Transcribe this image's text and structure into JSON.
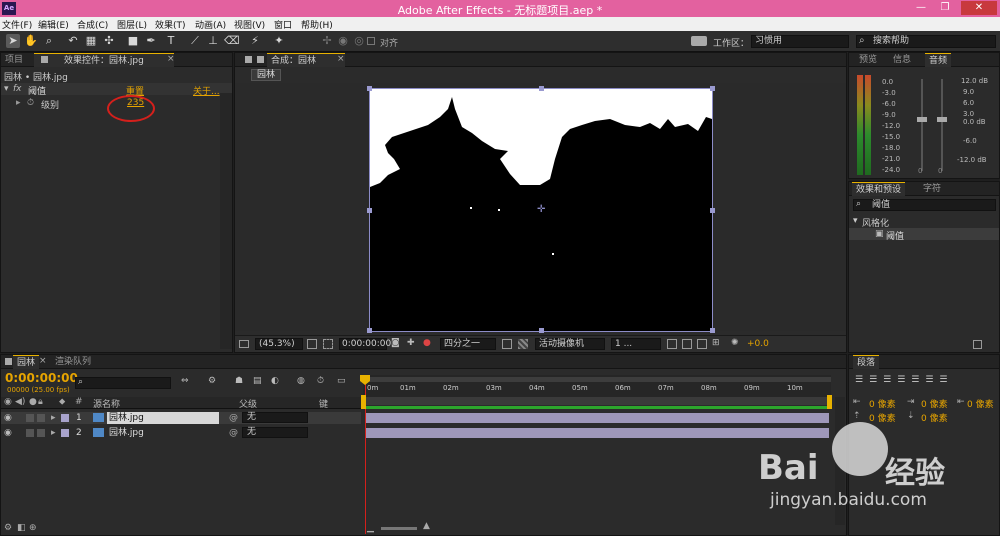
{
  "window": {
    "title": "Adobe After Effects - 无标题项目.aep *",
    "app_icon": "Ae"
  },
  "menu": [
    "文件(F)",
    "编辑(E)",
    "合成(C)",
    "图层(L)",
    "效果(T)",
    "动画(A)",
    "视图(V)",
    "窗口",
    "帮助(H)"
  ],
  "toolbar": {
    "align_label": "对齐",
    "workspace_label": "工作区：",
    "workspace_value": "习惯用",
    "search_placeholder": "搜索帮助"
  },
  "effect_controls": {
    "tab_project": "项目",
    "tab_label": "效果控件：园林.jpg",
    "layer_path": "园林 • 园林.jpg",
    "effect_name": "阈值",
    "reset_label": "重置",
    "about_label": "关于...",
    "param_label": "级别",
    "param_value": "235"
  },
  "composition": {
    "tab_label": "合成：园林",
    "comp_name": "园林",
    "zoom": "(45.3%)",
    "timecode": "0:00:00:00",
    "resolution": "四分之一",
    "camera": "活动摄像机",
    "views": "1 ...",
    "exposure": "+0.0"
  },
  "audio": {
    "tab_preview": "预览",
    "tab_info": "信息",
    "tab_audio": "音频",
    "left_scale": [
      "0.0",
      "-3.0",
      "-6.0",
      "-9.0",
      "-12.0",
      "-15.0",
      "-18.0",
      "-21.0",
      "-24.0"
    ],
    "right_scale_db": [
      "12.0 dB",
      "9.0",
      "6.0",
      "3.0",
      "0.0 dB",
      "-6.0",
      "-12.0 dB"
    ],
    "zero_a": "0",
    "zero_b": "0"
  },
  "effects_presets": {
    "tab_label": "效果和预设",
    "tab_char": "字符",
    "search_value": "阈值",
    "category": "风格化",
    "item": "阈值"
  },
  "paragraph": {
    "tab_label": "段落",
    "indent_a": "0 像素",
    "indent_b": "0 像素",
    "indent_c": "0 像素",
    "space_a": "0 像素",
    "space_b": "0 像素"
  },
  "timeline": {
    "tab_comp": "园林",
    "tab_render": "渲染队列",
    "timecode": "0:00:00:00",
    "frames": "00000 (25.00 fps)",
    "col_source": "源名称",
    "col_parent": "父级",
    "col_key": "键",
    "col_num": "#",
    "ruler": [
      "0m",
      "01m",
      "02m",
      "03m",
      "04m",
      "05m",
      "06m",
      "07m",
      "08m",
      "09m",
      "10m"
    ],
    "layers": [
      {
        "num": "1",
        "name": "园林.jpg",
        "parent": "无"
      },
      {
        "num": "2",
        "name": "园林.jpg",
        "parent": "无"
      }
    ]
  },
  "watermark": {
    "brand": "Bai",
    "cn": "经验",
    "url": "jingyan.baidu.com"
  }
}
